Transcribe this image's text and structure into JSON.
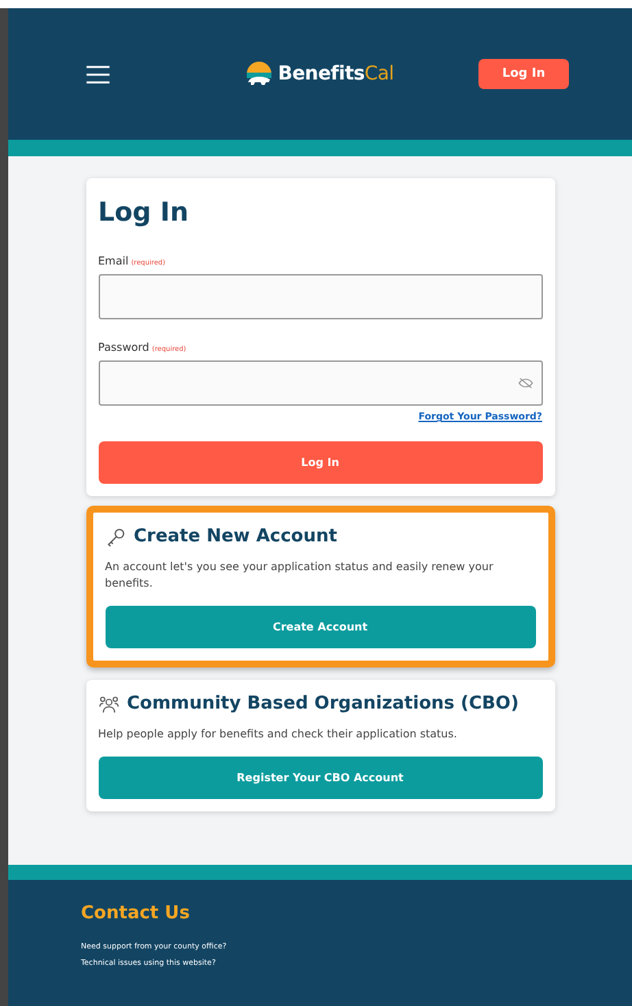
{
  "header": {
    "logo": {
      "name": "Benefits",
      "accent": "Cal"
    },
    "login_button": "Log In"
  },
  "login_card": {
    "title": "Log In",
    "fields": [
      {
        "label": "Email",
        "required": "(required)",
        "kind": "text"
      },
      {
        "label": "Password",
        "required": "(required)",
        "kind": "password"
      }
    ],
    "forgot_link": "Forgot Your Password?",
    "submit": "Log In"
  },
  "cards": [
    {
      "kind": "account",
      "title": "Create New Account",
      "text": "An account let's you see your application status and easily renew your benefits.",
      "button": "Create Account",
      "highlighted": true
    },
    {
      "kind": "organization",
      "title": "Community Based Organizations (CBO)",
      "text": "Help people apply for benefits and check their application status.",
      "button": "Register Your CBO Account",
      "highlighted": false
    }
  ],
  "footer": {
    "title": "Contact Us",
    "lines": [
      "Need support from your county office?",
      "Technical issues using this website?"
    ]
  }
}
